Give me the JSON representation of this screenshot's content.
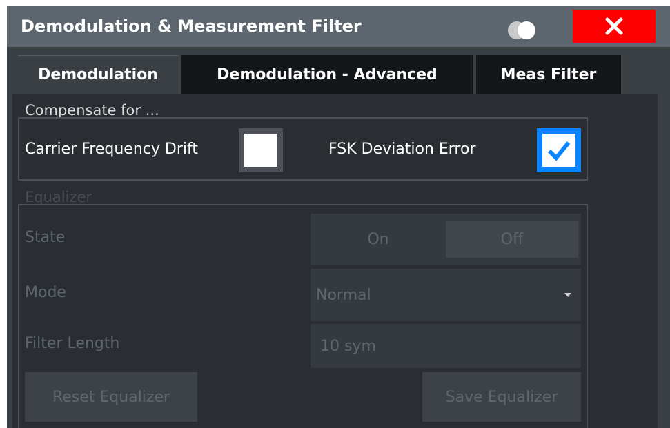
{
  "window": {
    "title": "Demodulation & Measurement Filter"
  },
  "tabs": [
    {
      "label": "Demodulation",
      "active": true
    },
    {
      "label": "Demodulation - Advanced",
      "active": false
    },
    {
      "label": "Meas Filter",
      "active": false
    }
  ],
  "compensate": {
    "heading": "Compensate for ...",
    "carrier_label": "Carrier Frequency Drift",
    "carrier_checked": false,
    "fsk_label": "FSK Deviation Error",
    "fsk_checked": true
  },
  "equalizer": {
    "heading": "Equalizer",
    "state_label": "State",
    "state_on": "On",
    "state_off": "Off",
    "state_selected": "Off",
    "mode_label": "Mode",
    "mode_value": "Normal",
    "filter_length_label": "Filter Length",
    "filter_length_value": "10 sym",
    "reset_button": "Reset Equalizer",
    "save_button": "Save Equalizer"
  },
  "colors": {
    "close_red": "#ff0000",
    "checkbox_accent": "#0a84ff",
    "disabled_text": "#5e666e"
  }
}
